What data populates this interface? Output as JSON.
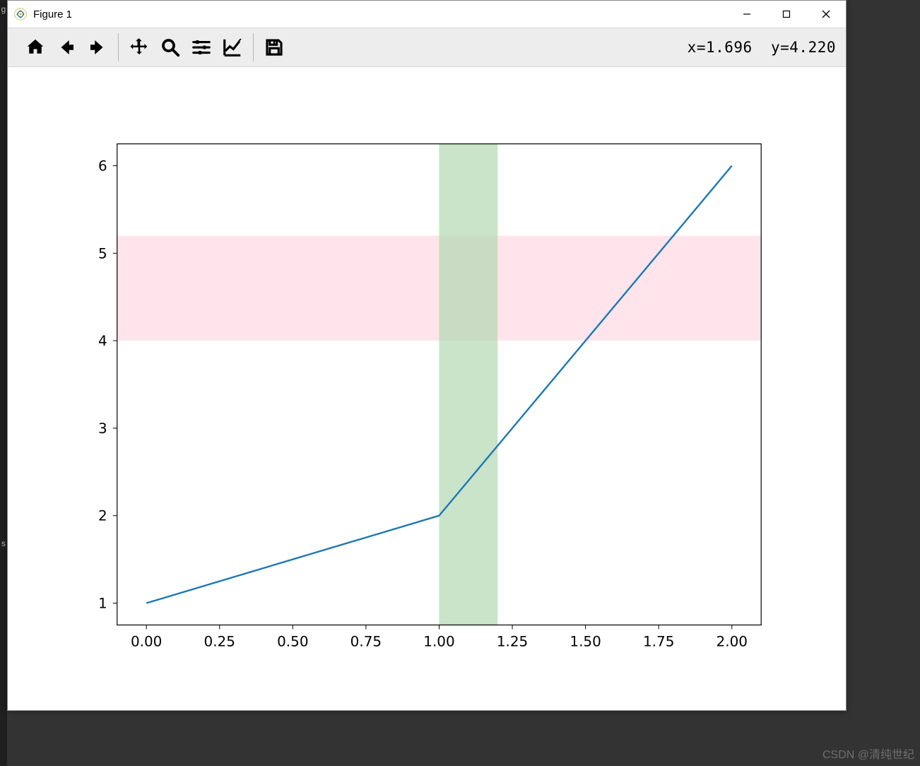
{
  "window": {
    "title": "Figure 1"
  },
  "toolbar": {
    "home": "Home",
    "back": "Back",
    "forward": "Forward",
    "pan": "Pan",
    "zoom": "Zoom",
    "subplots": "Configure subplots",
    "edit": "Edit axis",
    "save": "Save"
  },
  "status": {
    "x_label": "x=",
    "x_value": "1.696",
    "y_label": "y=",
    "y_value": "4.220"
  },
  "chart_data": {
    "type": "line",
    "x": [
      0,
      1,
      2
    ],
    "y": [
      1,
      2,
      6
    ],
    "xlim": [
      -0.1,
      2.1
    ],
    "ylim": [
      0.75,
      6.25
    ],
    "xticks": [
      0.0,
      0.25,
      0.5,
      0.75,
      1.0,
      1.25,
      1.5,
      1.75,
      2.0
    ],
    "yticks": [
      1,
      2,
      3,
      4,
      5,
      6
    ],
    "xtick_labels": [
      "0.00",
      "0.25",
      "0.50",
      "0.75",
      "1.00",
      "1.25",
      "1.50",
      "1.75",
      "2.00"
    ],
    "ytick_labels": [
      "1",
      "2",
      "3",
      "4",
      "5",
      "6"
    ],
    "line_color": "#1f77b4",
    "axvspan": {
      "xmin": 1.0,
      "xmax": 1.2,
      "color": "#b2d8b2",
      "alpha": 0.7
    },
    "axhspan": {
      "ymin": 4.0,
      "ymax": 5.2,
      "color": "#ffe0e7",
      "alpha": 0.85
    },
    "title": "",
    "xlabel": "",
    "ylabel": ""
  },
  "watermark": "CSDN @清纯世纪"
}
